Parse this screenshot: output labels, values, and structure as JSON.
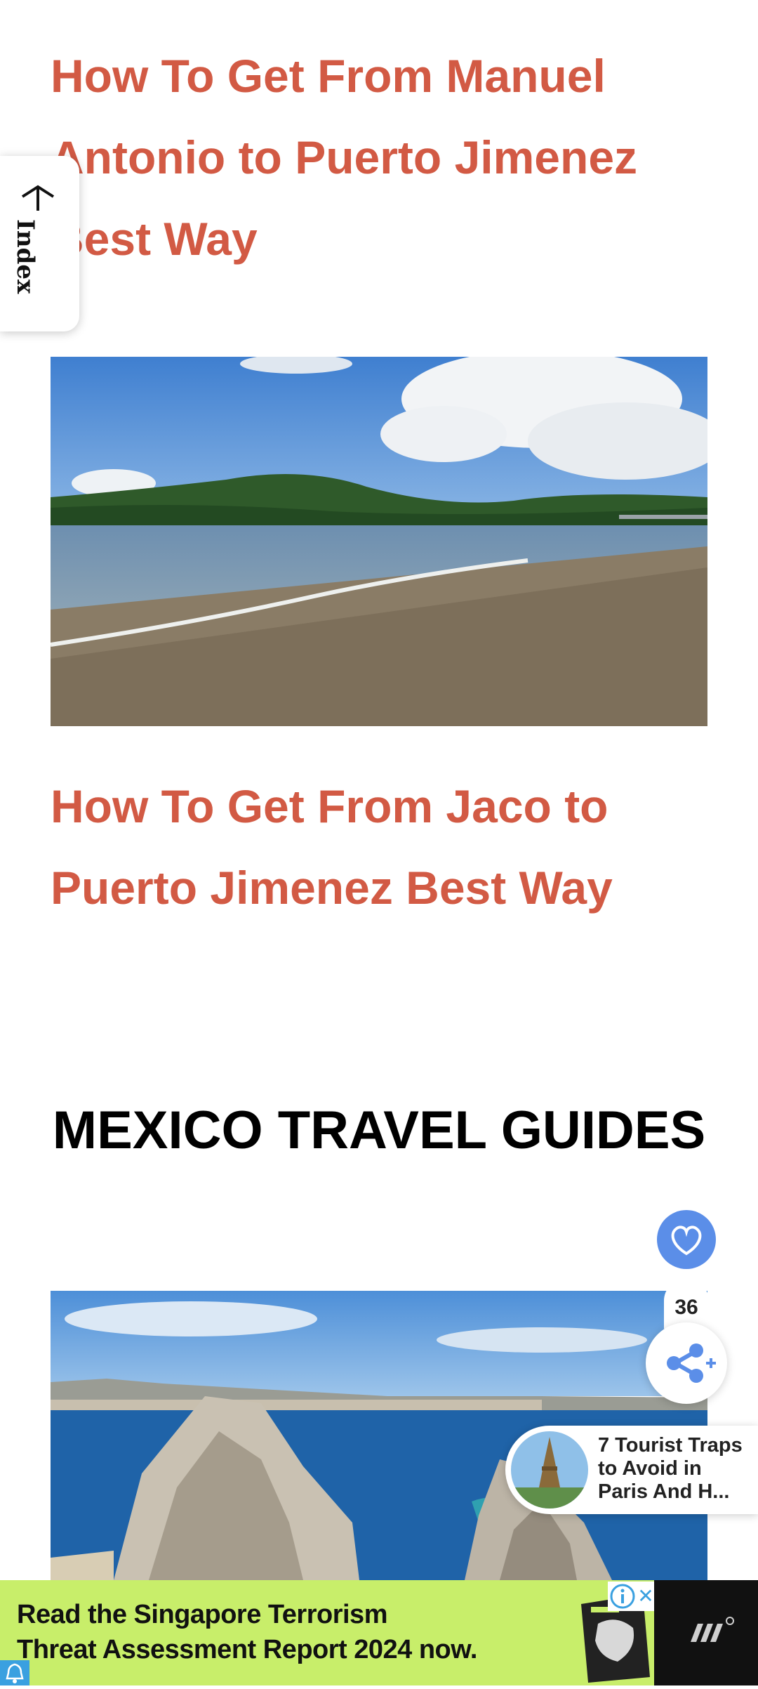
{
  "index_tab": {
    "arrow": "↑",
    "label": "Index"
  },
  "articles": [
    {
      "title": "How To Get From Manuel Antonio to Puerto Jimenez Best Way"
    },
    {
      "title": "How To Get From Jaco to Puerto Jimenez Best Way"
    }
  ],
  "section": {
    "title": "MEXICO TRAVEL GUIDES"
  },
  "social": {
    "like_icon": "heart-icon",
    "share_count": "36",
    "share_icon": "share-icon"
  },
  "recommendation": {
    "line1": "7 Tourist Traps",
    "line2": "to Avoid in",
    "line3": "Paris And H..."
  },
  "ad": {
    "line1": "Read the Singapore Terrorism",
    "line2": "Threat Assessment Report 2024 now.",
    "info_icon": "info-icon",
    "close_icon": "close-icon",
    "background": "#c8ee6a"
  },
  "colors": {
    "link": "#d25a44",
    "heart_button": "#5b8ee8",
    "share_icon": "#5b8ee8"
  }
}
